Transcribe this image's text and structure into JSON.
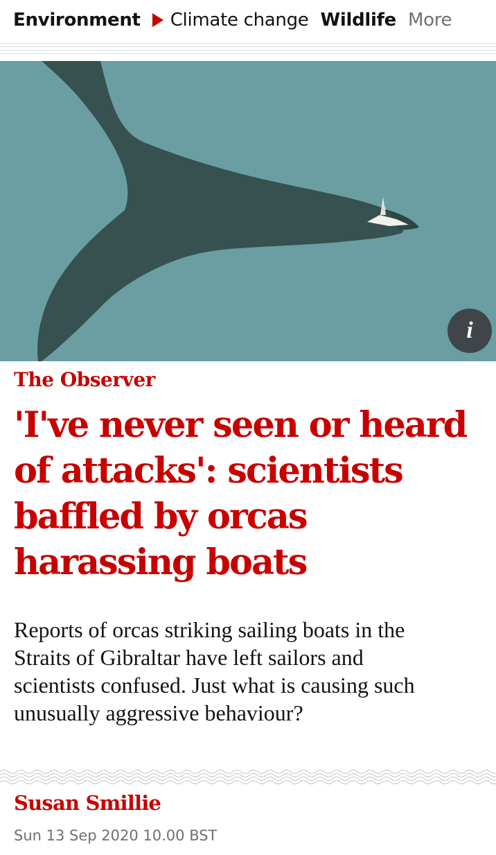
{
  "nav": {
    "section": "Environment",
    "items": [
      "Climate change",
      "Wildlife",
      "More"
    ]
  },
  "hero": {
    "alt_icon": "info-icon",
    "info_label": "i"
  },
  "article": {
    "series": "The Observer",
    "headline": "'I've never seen or heard of attacks': scientists baffled by orcas harassing boats",
    "standfirst": "Reports of orcas striking sailing boats in the Straits of Gibraltar have left sailors and scientists confused. Just what is causing such unusually aggressive behaviour?",
    "byline": "Susan Smillie",
    "dateline": "Sun 13 Sep 2020 10.00 BST"
  },
  "colors": {
    "accent": "#c70000",
    "hero_sea": "#6a9ea3",
    "orca": "#36514f"
  }
}
